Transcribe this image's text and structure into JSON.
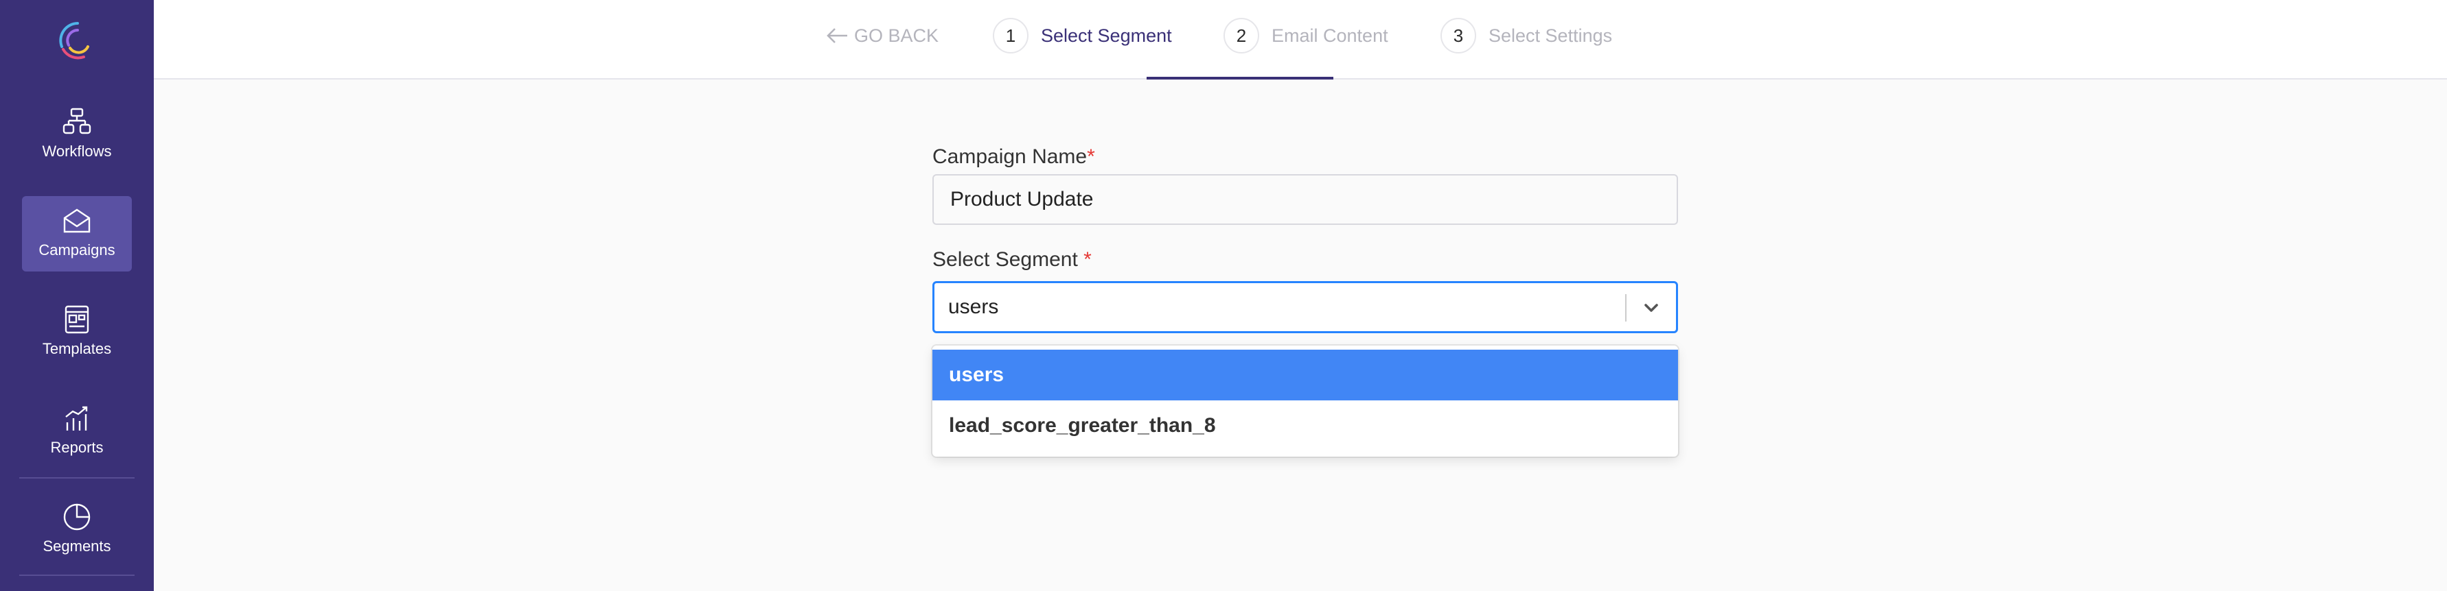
{
  "sidebar": {
    "items": [
      {
        "label": "Workflows",
        "icon": "workflow-icon"
      },
      {
        "label": "Campaigns",
        "icon": "mail-icon"
      },
      {
        "label": "Templates",
        "icon": "template-icon"
      },
      {
        "label": "Reports",
        "icon": "reports-icon"
      },
      {
        "label": "Segments",
        "icon": "pie-chart-icon"
      }
    ],
    "active": "Campaigns"
  },
  "header": {
    "go_back": "GO BACK",
    "steps": [
      {
        "number": "1",
        "label": "Select Segment"
      },
      {
        "number": "2",
        "label": "Email Content"
      },
      {
        "number": "3",
        "label": "Select Settings"
      }
    ],
    "active_step": "1"
  },
  "form": {
    "campaign_name": {
      "label": "Campaign Name",
      "required": "*",
      "value": "Product Update"
    },
    "segment": {
      "label": "Select Segment",
      "required": "*",
      "value": "users",
      "options": [
        "users",
        "lead_score_greater_than_8"
      ],
      "highlighted_option": "users"
    }
  },
  "colors": {
    "sidebar_bg": "#3a3077",
    "sidebar_active": "#5a51a3",
    "focus_border": "#2684ff",
    "option_highlight": "#4186f5",
    "required": "#e53935"
  }
}
